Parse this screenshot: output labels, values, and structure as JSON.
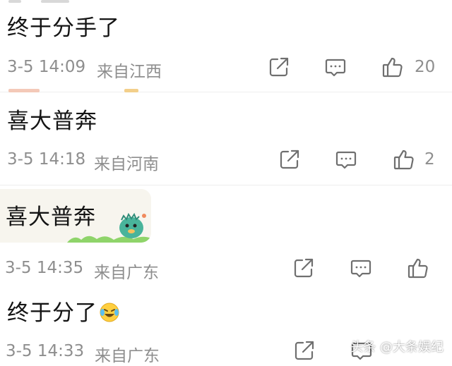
{
  "comments": [
    {
      "text": "终于分手了",
      "time": "3-5 14:09",
      "location": "来自江西",
      "likes": "20"
    },
    {
      "text": "喜大普奔",
      "time": "3-5 14:18",
      "location": "来自河南",
      "likes": "2"
    },
    {
      "text": "喜大普奔",
      "time": "3-5 14:35",
      "location": "来自广东",
      "likes": ""
    },
    {
      "text": "终于分了",
      "time": "3-5 14:33",
      "location": "来自广东",
      "likes": ""
    }
  ],
  "icons": {
    "share": "share-icon",
    "reply": "comment-icon",
    "like": "thumbs-up-icon",
    "emoji": "laughing-crying-emoji",
    "sticker": "dinosaur-sticker"
  },
  "watermark": "头条 @大条娱纪",
  "colors": {
    "meta": "#8e8e8e",
    "text": "#141414",
    "divider": "#eeeeee"
  }
}
